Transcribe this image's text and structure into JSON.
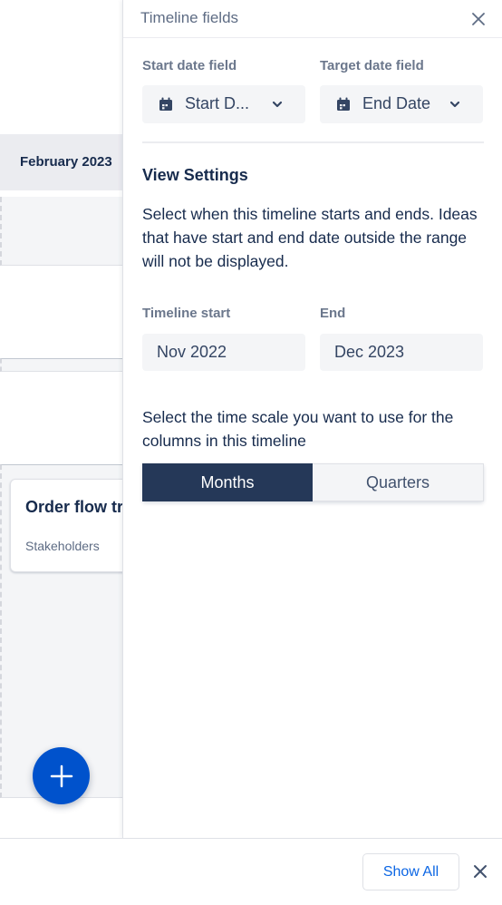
{
  "timeline": {
    "month_header": "February 2023",
    "idea_card": {
      "title": "Order flow tr",
      "subtitle": "Stakeholders"
    },
    "add_button_icon": "plus-icon"
  },
  "panel": {
    "title": "Timeline fields",
    "close_icon": "close-icon",
    "start_date_field": {
      "label": "Start date field",
      "value": "Start D...",
      "icon": "calendar-icon"
    },
    "target_date_field": {
      "label": "Target date field",
      "value": "End Date",
      "icon": "calendar-icon"
    },
    "view_settings": {
      "title": "View Settings",
      "description": "Select when this timeline starts and ends. Ideas that have start and end date outside the range will not be displayed.",
      "timeline_start_label": "Timeline start",
      "timeline_start_value": "Nov 2022",
      "end_label": "End",
      "end_value": "Dec 2023",
      "scale_description": "Select the time scale you want to use for the columns in this timeline",
      "scale_options": [
        "Months",
        "Quarters"
      ],
      "scale_selected": "Months"
    }
  },
  "footer": {
    "show_all_label": "Show All",
    "close_icon": "close-icon"
  },
  "colors": {
    "primary_blue": "#0052cc",
    "link_blue": "#0c66e4",
    "selected_segment": "#253858",
    "text_dark": "#172b4d",
    "text_muted": "#6b778c"
  }
}
